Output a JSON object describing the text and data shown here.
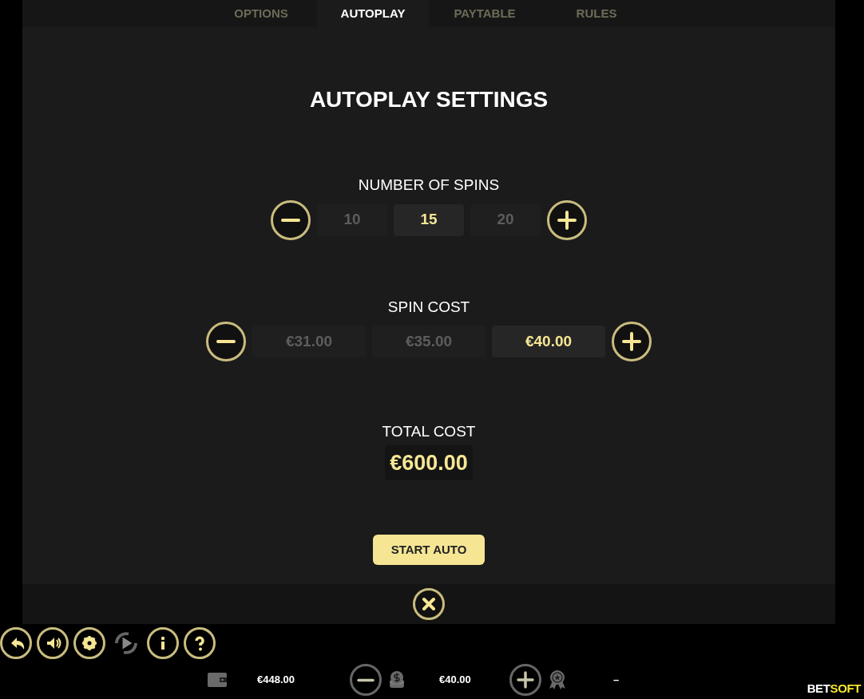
{
  "tabs": [
    {
      "label": "OPTIONS",
      "selected": false
    },
    {
      "label": "AUTOPLAY",
      "selected": true
    },
    {
      "label": "PAYTABLE",
      "selected": false
    },
    {
      "label": "RULES",
      "selected": false
    }
  ],
  "title": "AUTOPLAY SETTINGS",
  "pickers": [
    {
      "label": "NUMBER OF SPINS",
      "options": [
        {
          "value": "10",
          "selected": false
        },
        {
          "value": "15",
          "selected": true
        },
        {
          "value": "20",
          "selected": false
        }
      ]
    },
    {
      "label": "SPIN COST",
      "options": [
        {
          "value": "€31.00",
          "selected": false
        },
        {
          "value": "€35.00",
          "selected": false
        },
        {
          "value": "€40.00",
          "selected": true
        }
      ]
    }
  ],
  "total": {
    "label": "TOTAL COST",
    "value": "€600.00"
  },
  "start_button": "START AUTO",
  "toolbar": [
    {
      "kind": "back",
      "disabled": false
    },
    {
      "kind": "sound",
      "disabled": false
    },
    {
      "kind": "settings",
      "disabled": false
    },
    {
      "kind": "autoplay",
      "disabled": true
    },
    {
      "kind": "info",
      "disabled": false
    },
    {
      "kind": "help",
      "disabled": false
    }
  ],
  "status": {
    "balance": "€448.00",
    "bet": "€40.00",
    "win": "–"
  },
  "logo": {
    "first": "BET",
    "second": "SOFT"
  }
}
